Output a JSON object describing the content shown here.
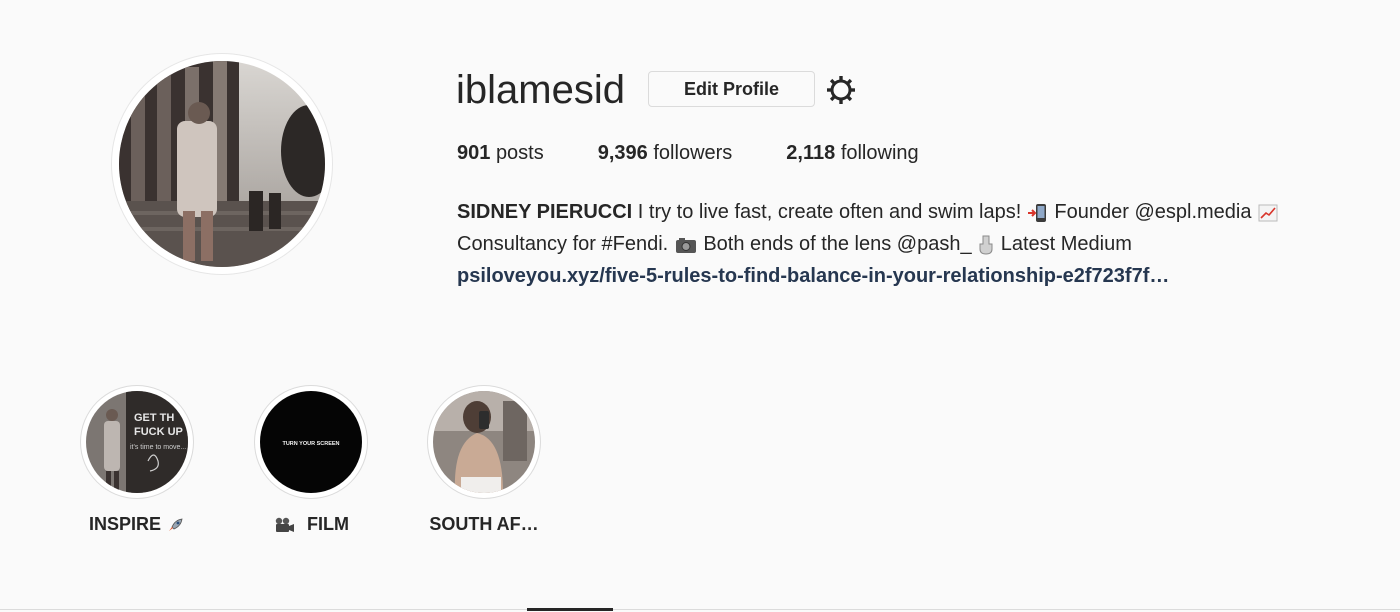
{
  "profile": {
    "username": "iblamesid",
    "edit_button": "Edit Profile",
    "settings_icon": "gear-icon"
  },
  "stats": {
    "posts_count": "901",
    "posts_label": "posts",
    "followers_count": "9,396",
    "followers_label": "followers",
    "following_count": "2,118",
    "following_label": "following"
  },
  "bio": {
    "full_name": "SIDNEY PIERUCCI",
    "text_1": " I try to live fast, create often and swim laps! ",
    "text_2": " Founder @espl.media ",
    "text_3": " Consultancy for #Fendi. ",
    "text_4": " Both ends of the lens @pash_ ",
    "text_5": "  Latest Medium",
    "link": "psiloveyou.xyz/five-5-rules-to-find-balance-in-your-relationship-e2f723f7f…",
    "icons": [
      "phone-icon",
      "chart-icon",
      "camera-icon",
      "pointing-down-icon"
    ]
  },
  "highlights": [
    {
      "label": "INSPIRE",
      "icon": "rocket-icon"
    },
    {
      "label": "FILM",
      "icon": "movie-camera-icon",
      "cover_text": "TURN YOUR SCREEN"
    },
    {
      "label": "SOUTH AF…"
    }
  ]
}
